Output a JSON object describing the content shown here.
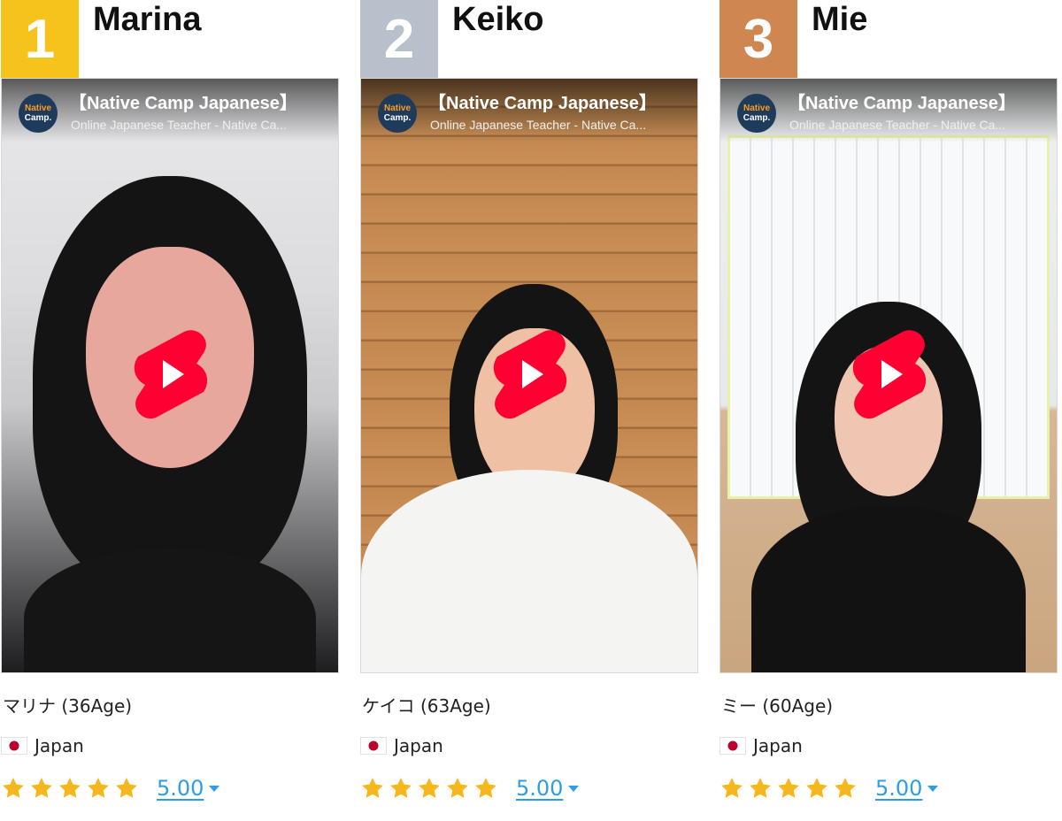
{
  "cards": [
    {
      "rank": "1",
      "rank_color": "#f6c21c",
      "name": "Marina",
      "video": {
        "channel_logo_line1": "Native",
        "channel_logo_line2": "Camp.",
        "title": "【Native Camp Japanese】",
        "subtitle": "Online Japanese Teacher - Native Ca..."
      },
      "japanese_name": "マリナ (36Age)",
      "country": "Japan",
      "rating": "5.00",
      "stars": 5
    },
    {
      "rank": "2",
      "rank_color": "#b8c0cc",
      "name": "Keiko",
      "video": {
        "channel_logo_line1": "Native",
        "channel_logo_line2": "Camp.",
        "title": "【Native Camp Japanese】",
        "subtitle": "Online Japanese Teacher - Native Ca..."
      },
      "japanese_name": "ケイコ (63Age)",
      "country": "Japan",
      "rating": "5.00",
      "stars": 5
    },
    {
      "rank": "3",
      "rank_color": "#cf8650",
      "name": "Mie",
      "video": {
        "channel_logo_line1": "Native",
        "channel_logo_line2": "Camp.",
        "title": "【Native Camp Japanese】",
        "subtitle": "Online Japanese Teacher - Native Ca..."
      },
      "japanese_name": "ミー (60Age)",
      "country": "Japan",
      "rating": "5.00",
      "stars": 5
    }
  ],
  "colors": {
    "star": "#f6b71c",
    "rating_link": "#2b9ee6",
    "play_button": "#ff0033"
  },
  "icons": {
    "play": "youtube-shorts-play-icon",
    "star": "star-icon",
    "flag": "japan-flag-icon",
    "caret": "caret-down-icon"
  }
}
